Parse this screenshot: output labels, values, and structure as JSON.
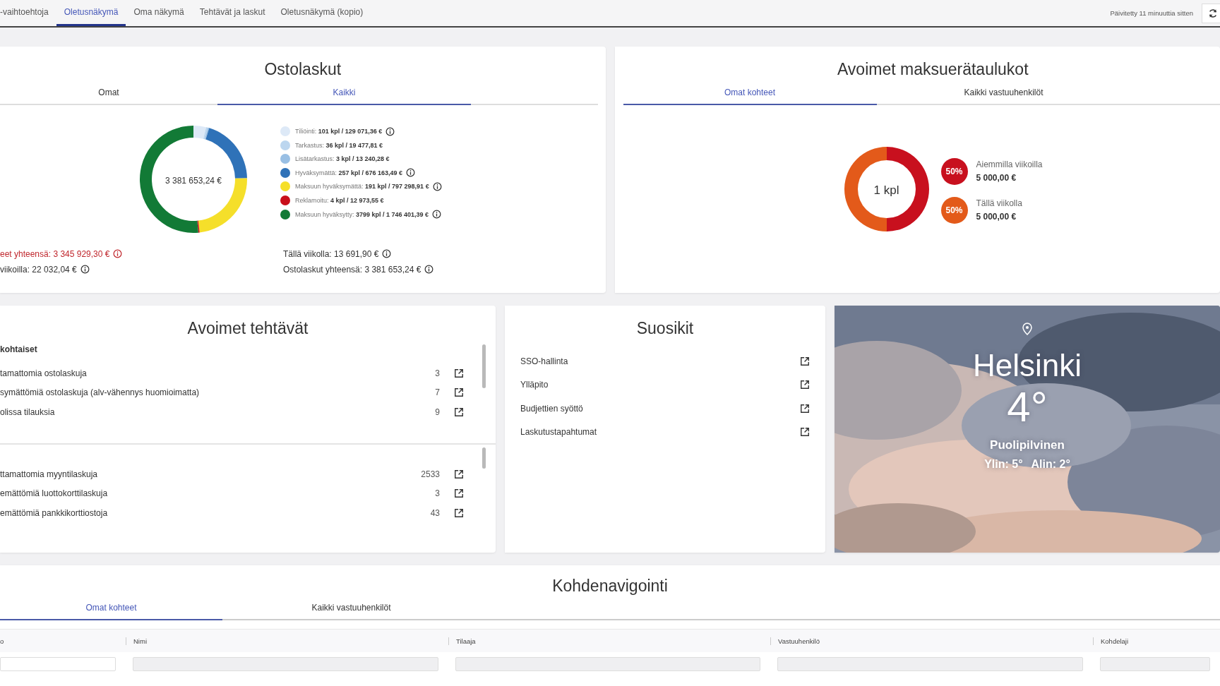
{
  "top_tabs": [
    {
      "label": "-vaihtoehtoja",
      "selected": false
    },
    {
      "label": "Oletusnäkymä",
      "selected": true
    },
    {
      "label": "Oma näkymä",
      "selected": false
    },
    {
      "label": "Tehtävät ja laskut",
      "selected": false
    },
    {
      "label": "Oletusnäkymä (kopio)",
      "selected": false
    }
  ],
  "updated": "Päivitetty 11 minuuttia sitten",
  "purchase_invoices": {
    "title": "Ostolaskut",
    "tabs": [
      {
        "label": "Omat",
        "selected": false
      },
      {
        "label": "Kaikki",
        "selected": true
      }
    ],
    "total_label": "3 381 653,24 €",
    "chart_data": {
      "type": "donut",
      "categories": [
        "Tiliöinti",
        "Tarkastus",
        "Lisätarkastus",
        "Hyväksymättä",
        "Maksuun hyväksymättä",
        "Reklamoitu",
        "Maksuun hyväksytty"
      ],
      "values": [
        3.8,
        0.57,
        0.39,
        19.92,
        23.49,
        0.38,
        51.45
      ]
    },
    "legend": [
      {
        "detail": ": **101 kpl / 129 071,36 €**",
        "color": "#dde9f7",
        "info": true
      },
      {
        "detail": ": **36 kpl / 19 477,81 €**",
        "color": "#bcd6ef",
        "info": false
      },
      {
        "detail": ": **3 kpl / 13 240,28 €**",
        "color": "#99bfe4",
        "info": false
      },
      {
        "detail": ": **257 kpl / 676 163,49 €**",
        "color": "#2f72b8",
        "info": true
      },
      {
        "detail": ": **191 kpl / 797 298,91 €**",
        "color": "#f5df2a",
        "info": true
      },
      {
        "detail": ": **4 kpl / 12 973,55 €**",
        "color": "#c90f1b",
        "info": false
      },
      {
        "detail": ": **3799 kpl / 1 746 401,39 €**",
        "color": "#127a36",
        "info": true
      }
    ],
    "summary_left": [
      {
        "text": "eet yhteensä: 3 345 929,30 €",
        "kind": "alert"
      },
      {
        "text": "viikoilla: 22 032,04 €",
        "kind": "normal"
      }
    ],
    "summary_right": [
      {
        "text": "Tällä viikolla: 13 691,90 €",
        "kind": "normal"
      },
      {
        "text": "Ostolaskut yhteensä: 3 381 653,24 €",
        "kind": "normal"
      }
    ]
  },
  "payment_schedules": {
    "title": "Avoimet maksuerätaulukot",
    "tabs": [
      {
        "label": "Omat kohteet",
        "selected": true
      },
      {
        "label": "Kaikki vastuuhenkilöt",
        "selected": false
      }
    ],
    "center_label": "1 kpl",
    "chart_data": {
      "type": "donut",
      "categories": [
        "Aiemmilla viikoilla",
        "Tällä viikolla"
      ],
      "values": [
        50,
        50
      ]
    },
    "legend": [
      {
        "percent": "50%",
        "amount": "5 000,00 €",
        "color": "#c8101e"
      },
      {
        "percent": "50%",
        "amount": "5 000,00 €",
        "color": "#e35a1a"
      }
    ]
  },
  "tasks": {
    "title": "Avoimet tehtävät",
    "sections": [
      {
        "heading": "kohtaiset",
        "rows": [
          {
            "label": "tamattomia ostolaskuja",
            "count": "3"
          },
          {
            "label": "symättömiä ostolaskuja (alv-vähennys huomioimatta)",
            "count": "7"
          },
          {
            "label": "olissa tilauksia",
            "count": "9"
          }
        ]
      },
      {
        "rows": [
          {
            "label": "ttamattomia myyntilaskuja",
            "count": "2533"
          },
          {
            "label": "emättömiä luottokorttilaskuja",
            "count": "3"
          },
          {
            "label": "emättömiä pankkikorttiostoja",
            "count": "43"
          }
        ]
      }
    ]
  },
  "favorites": {
    "title": "Suosikit",
    "items": [
      "SSO-hallinta",
      "Ylläpito",
      "Budjettien syöttö",
      "Laskutustapahtumat"
    ]
  },
  "weather": {
    "city": "Helsinki",
    "temperature": "4°",
    "condition": "Puolipilvinen",
    "high": "Ylin: 5°",
    "low": "Alin: 2°"
  },
  "navigation": {
    "title": "Kohdenavigointi",
    "tabs": [
      {
        "label": "Omat kohteet",
        "selected": true
      },
      {
        "label": "Kaikki vastuuhenkilöt",
        "selected": false
      }
    ],
    "columns": [
      {
        "label": "o",
        "filter_disabled": false
      },
      {
        "label": "Nimi",
        "filter_disabled": true
      },
      {
        "label": "Tilaaja",
        "filter_disabled": true
      },
      {
        "label": "Vastuuhenkilö",
        "filter_disabled": true
      },
      {
        "label": "Kohdelaji",
        "filter_disabled": true
      }
    ]
  }
}
